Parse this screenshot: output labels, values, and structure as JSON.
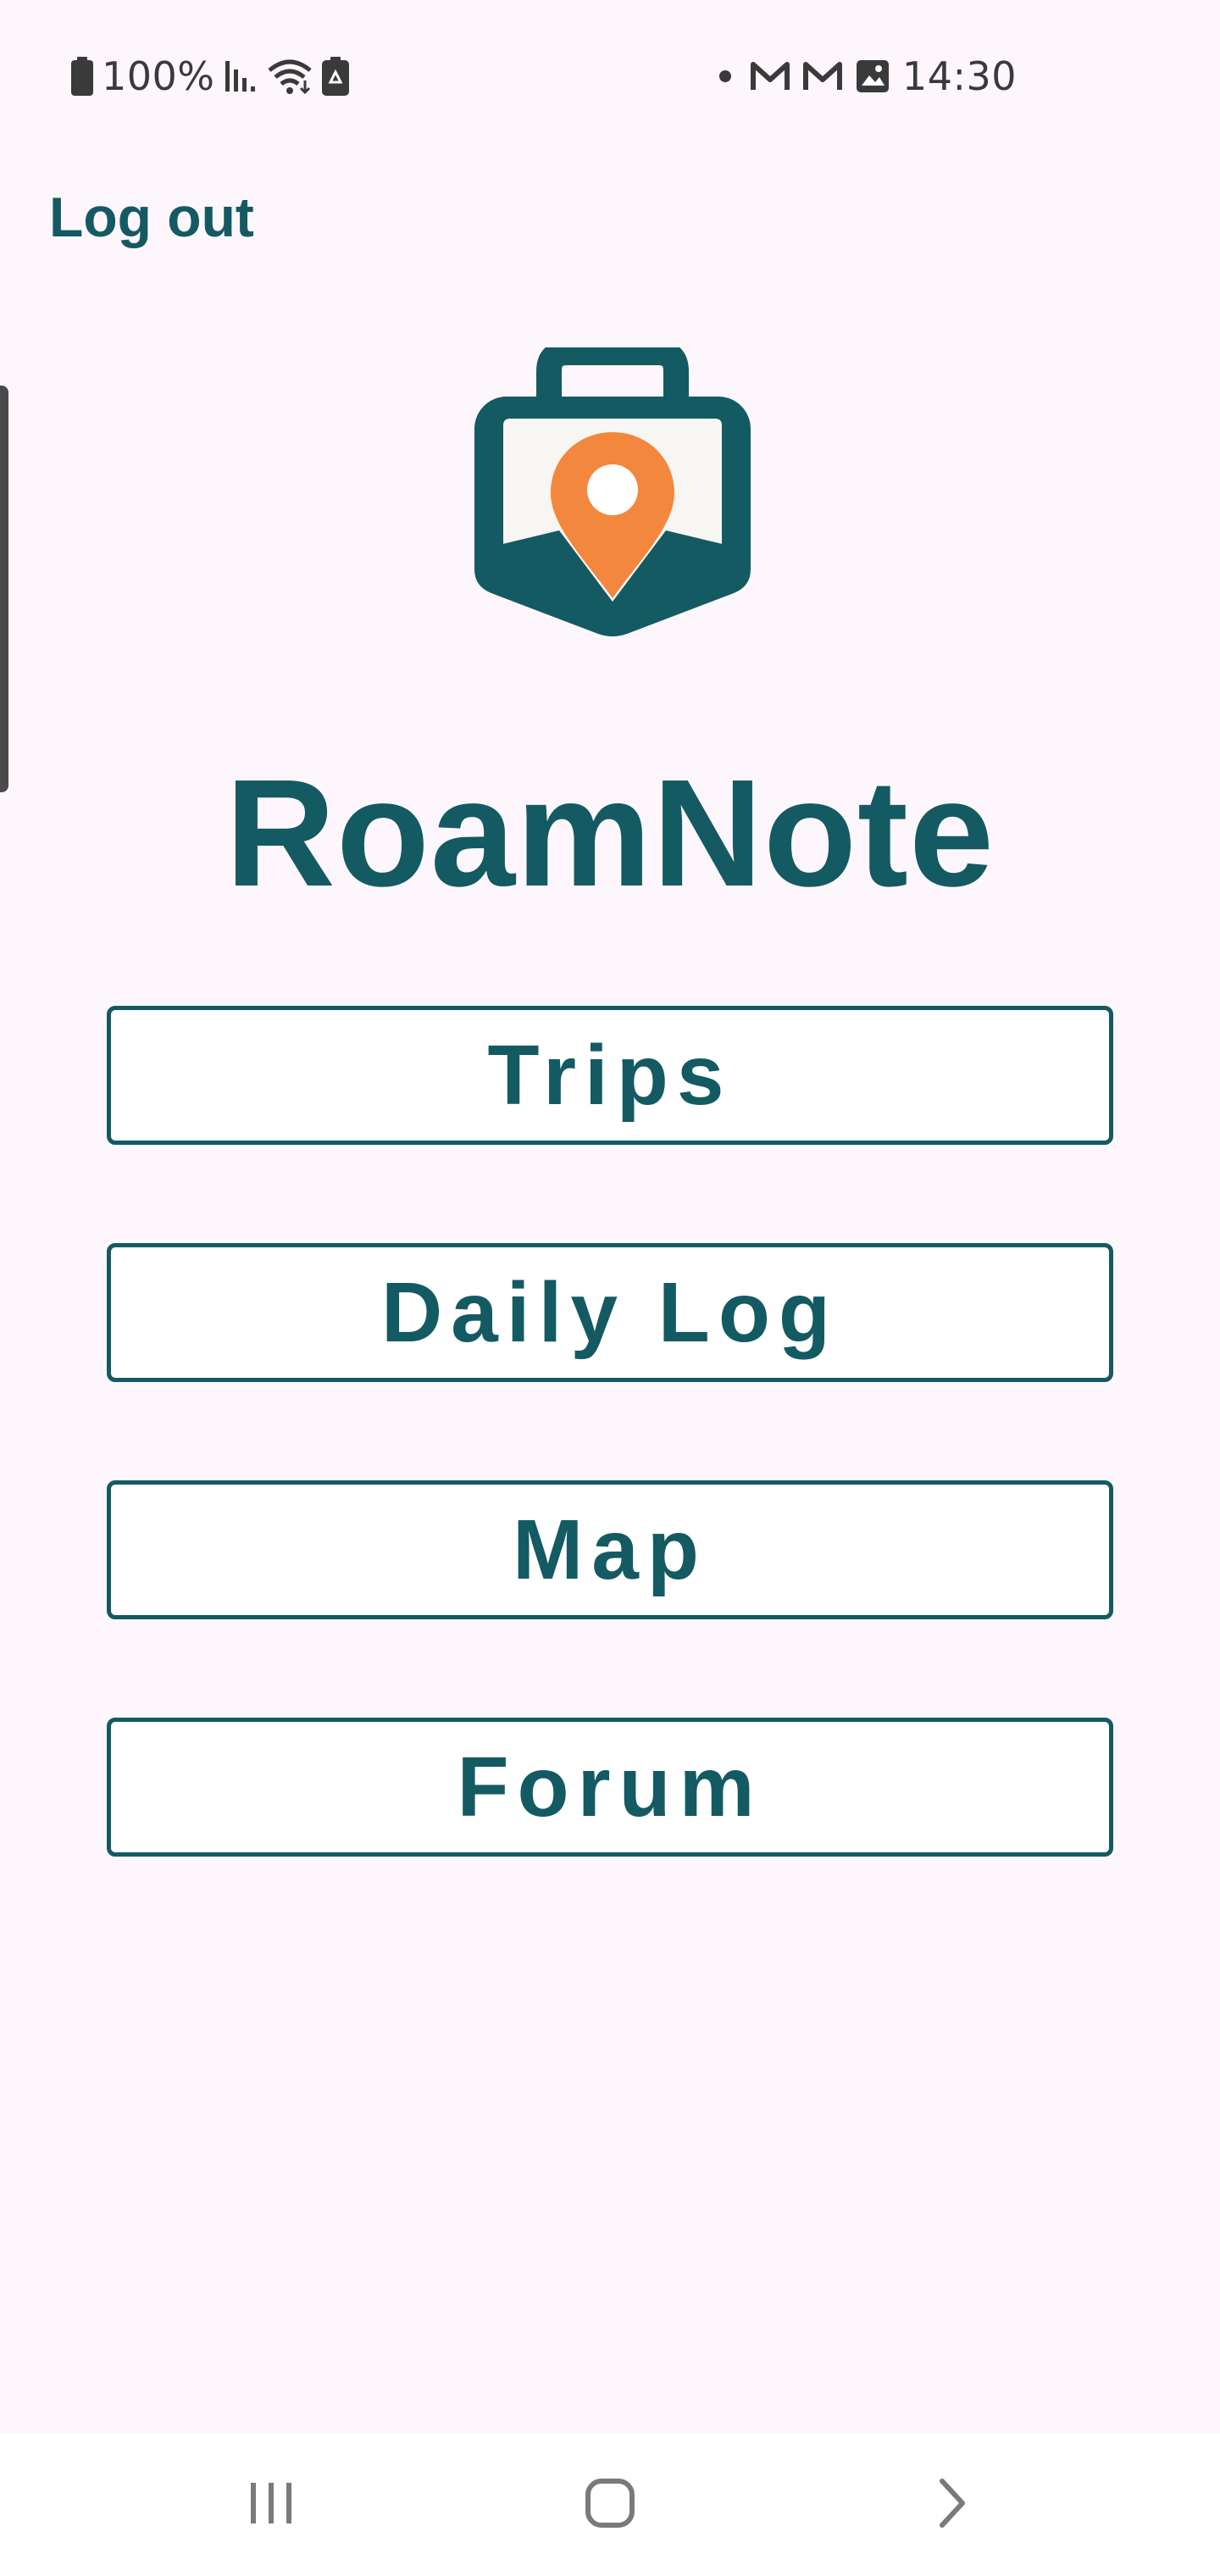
{
  "status_bar": {
    "battery": "100%",
    "time": "14:30",
    "left_icons": [
      "battery-icon",
      "signal-icon",
      "wifi-icon",
      "battery-saver-icon"
    ],
    "right_icons": [
      "notification-dot-icon",
      "gmail-icon",
      "gmail-icon",
      "gallery-icon"
    ]
  },
  "header": {
    "logout_label": "Log out"
  },
  "app": {
    "name": "RoamNote",
    "logo_icon": "suitcase-location-pin-icon"
  },
  "menu": {
    "items": [
      {
        "label": "Trips"
      },
      {
        "label": "Daily Log"
      },
      {
        "label": "Map"
      },
      {
        "label": "Forum"
      }
    ]
  },
  "nav_bar": {
    "icons": [
      "recent-apps-icon",
      "home-icon",
      "back-icon"
    ]
  },
  "colors": {
    "primary": "#145a63",
    "accent": "#f4873e",
    "background": "#fdf6fc",
    "button_fill": "#ffffff"
  }
}
